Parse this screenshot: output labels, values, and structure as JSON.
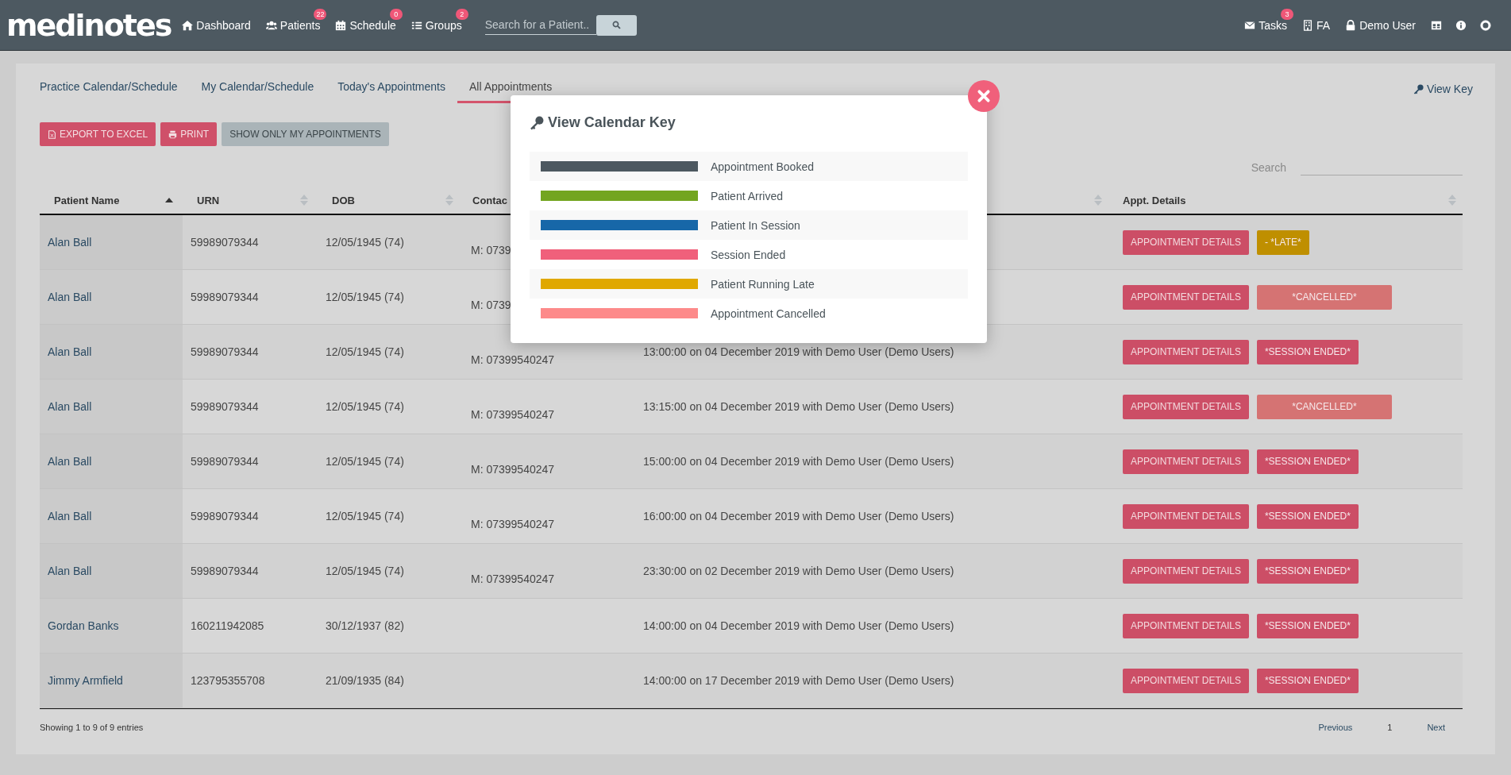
{
  "navbar": {
    "logo": "medinotes",
    "items": [
      {
        "label": "Dashboard"
      },
      {
        "label": "Patients",
        "badge": "22"
      },
      {
        "label": "Schedule",
        "badge": "0"
      },
      {
        "label": "Groups",
        "badge": "2"
      }
    ],
    "search": {
      "placeholder": "Search for a Patient.."
    },
    "right_items": [
      {
        "label": "Tasks",
        "badge": "3"
      },
      {
        "label": "FA"
      },
      {
        "label": "Demo User"
      }
    ]
  },
  "tabs": [
    {
      "label": "Practice Calendar/Schedule",
      "selected": false
    },
    {
      "label": "My Calendar/Schedule",
      "selected": false
    },
    {
      "label": "Today's Appointments",
      "selected": false
    },
    {
      "label": "All Appointments",
      "selected": true
    }
  ],
  "view_key": "View Key",
  "actions": [
    {
      "label": "EXPORT TO EXCEL",
      "kind": "excel"
    },
    {
      "label": "PRINT",
      "kind": "print"
    },
    {
      "label": "SHOW ONLY MY APPOINTMENTS",
      "kind": "plain"
    }
  ],
  "table_search": {
    "label": "Search"
  },
  "table": {
    "columns": [
      {
        "label": "Patient Name"
      },
      {
        "label": "URN"
      },
      {
        "label": "DOB"
      },
      {
        "label": "Contac"
      },
      {},
      {
        "label": "Appt. Details"
      }
    ],
    "rows": [
      {
        "name": "Alan Ball",
        "urn": "59989079344",
        "dob": "12/05/1945 (74)",
        "contact": "M: 0739",
        "status": {
          "label": "- *LATE*",
          "kind": "late"
        }
      },
      {
        "name": "Alan Ball",
        "urn": "59989079344",
        "dob": "12/05/1945 (74)",
        "contact": "M: 0739",
        "status": {
          "label": "*CANCELLED*",
          "kind": "cancelled"
        }
      },
      {
        "name": "Alan Ball",
        "urn": "59989079344",
        "dob": "12/05/1945 (74)",
        "contact": "M: 07399540247",
        "appointment": "13:00:00 on 04 December 2019 with Demo User (Demo Users)",
        "status": {
          "label": "*SESSION ENDED*",
          "kind": "ended"
        }
      },
      {
        "name": "Alan Ball",
        "urn": "59989079344",
        "dob": "12/05/1945 (74)",
        "contact": "M: 07399540247",
        "appointment": "13:15:00 on 04 December 2019 with Demo User (Demo Users)",
        "status": {
          "label": "*CANCELLED*",
          "kind": "cancelled"
        }
      },
      {
        "name": "Alan Ball",
        "urn": "59989079344",
        "dob": "12/05/1945 (74)",
        "contact": "M: 07399540247",
        "appointment": "15:00:00 on 04 December 2019 with Demo User (Demo Users)",
        "status": {
          "label": "*SESSION ENDED*",
          "kind": "ended"
        }
      },
      {
        "name": "Alan Ball",
        "urn": "59989079344",
        "dob": "12/05/1945 (74)",
        "contact": "M: 07399540247",
        "appointment": "16:00:00 on 04 December 2019 with Demo User (Demo Users)",
        "status": {
          "label": "*SESSION ENDED*",
          "kind": "ended"
        }
      },
      {
        "name": "Alan Ball",
        "urn": "59989079344",
        "dob": "12/05/1945 (74)",
        "contact": "M: 07399540247",
        "appointment": "23:30:00 on 02 December 2019 with Demo User (Demo Users)",
        "status": {
          "label": "*SESSION ENDED*",
          "kind": "ended"
        }
      },
      {
        "name": "Gordan Banks",
        "urn": "160211942085",
        "dob": "30/12/1937 (82)",
        "appointment": "14:00:00 on 04 December 2019 with Demo User (Demo Users)",
        "status": {
          "label": "*SESSION ENDED*",
          "kind": "ended"
        }
      },
      {
        "name": "Jimmy Armfield",
        "urn": "123795355708",
        "dob": "21/09/1935 (84)",
        "appointment": "14:00:00 on 17 December 2019 with Demo User (Demo Users)",
        "status": {
          "label": "*SESSION ENDED*",
          "kind": "ended"
        }
      }
    ],
    "details_buttons": [
      "APPOINTMENT DETAILS",
      "APPOINTMENT DETAILS",
      "APPOINTMENT DETAILS",
      "APPOINTMENT DETAILS",
      "APPOINTMENT DETAILS",
      "APPOINTMENT DETAILS",
      "APPOINTMENT DETAILS",
      "APPOINTMENT DETAILS",
      "APPOINTMENT DETAILS"
    ]
  },
  "footer": {
    "info": "Showing 1 to 9 of 9 entries",
    "pagination": [
      {
        "label": "Previous",
        "selected": false
      },
      {
        "label": "1",
        "selected": true
      },
      {
        "label": "Next",
        "selected": false
      }
    ]
  },
  "modal": {
    "title": "View Calendar Key",
    "items": [
      {
        "label": "Appointment Booked",
        "color": "#4d5860"
      },
      {
        "label": "Patient Arrived",
        "color": "#73a520"
      },
      {
        "label": "Patient In Session",
        "color": "#1767a8"
      },
      {
        "label": "Session Ended",
        "color": "#f0607b"
      },
      {
        "label": "Patient Running Late",
        "color": "#e0a800"
      },
      {
        "label": "Appointment Cancelled",
        "color": "#fd8a8a"
      }
    ]
  }
}
